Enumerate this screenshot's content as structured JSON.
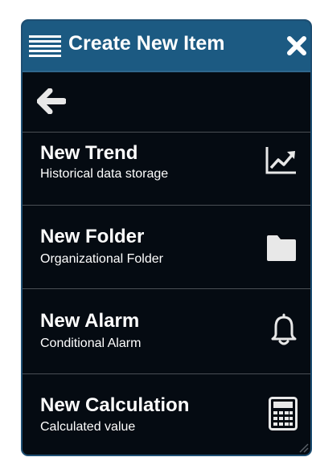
{
  "header": {
    "title": "Create New Item",
    "menu_icon": "hamburger-menu-icon",
    "close_icon": "close-x-icon"
  },
  "back": {
    "icon": "arrow-left-icon"
  },
  "items": [
    {
      "title": "New Trend",
      "subtitle": "Historical data storage",
      "icon": "trend-chart-icon"
    },
    {
      "title": "New Folder",
      "subtitle": "Organizational Folder",
      "icon": "folder-icon"
    },
    {
      "title": "New Alarm",
      "subtitle": "Conditional Alarm",
      "icon": "bell-icon"
    },
    {
      "title": "New Calculation",
      "subtitle": "Calculated value",
      "icon": "calculator-icon"
    }
  ],
  "colors": {
    "panel_background": "#050b12",
    "header_background": "#1c5a82",
    "border": "#1e4f73",
    "icon": "#e8e8e8",
    "divider": "#4a4f55"
  }
}
